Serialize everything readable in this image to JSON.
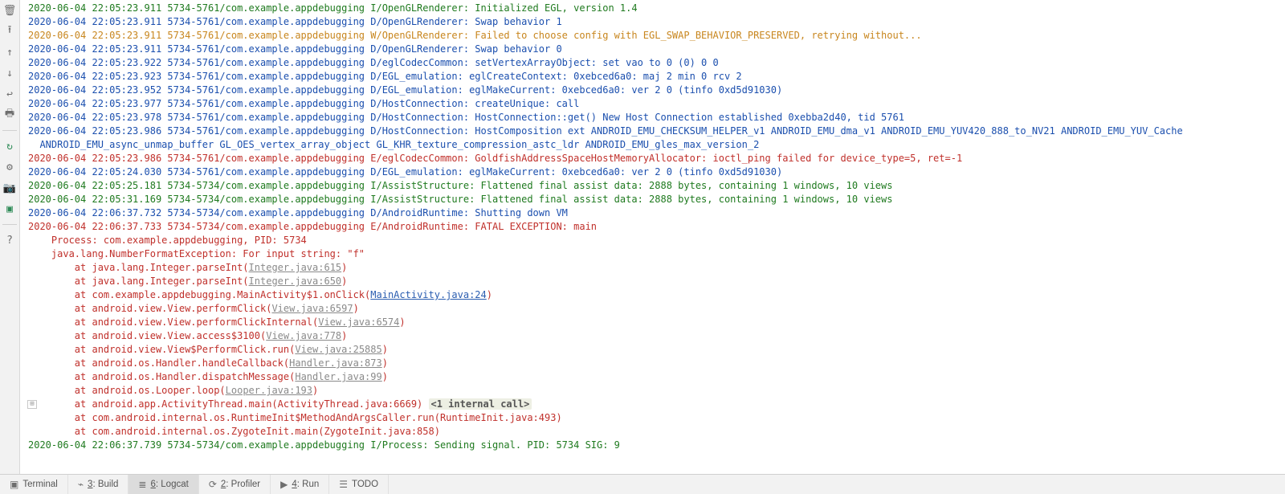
{
  "gutter": {
    "icons": [
      {
        "name": "trash-icon",
        "glyph": "🗑"
      },
      {
        "name": "scroll-end-icon",
        "glyph": "⭱"
      },
      {
        "name": "up-icon",
        "glyph": "↑"
      },
      {
        "name": "down-icon",
        "glyph": "↓"
      },
      {
        "name": "soft-wrap-icon",
        "glyph": "↩"
      },
      {
        "name": "print-icon",
        "glyph": "🖶"
      },
      {
        "sep": true
      },
      {
        "name": "restart-icon",
        "glyph": "↻",
        "cls": "green"
      },
      {
        "name": "settings-icon",
        "glyph": "⚙"
      },
      {
        "name": "screenshot-icon",
        "glyph": "📷",
        "cls": "blue"
      },
      {
        "name": "record-icon",
        "glyph": "▣",
        "cls": "green"
      },
      {
        "sep": true
      },
      {
        "name": "help-icon",
        "glyph": "?"
      }
    ]
  },
  "expand_glyph": "⊞",
  "log": {
    "prefix_pkg": "com.example.appdebugging",
    "lines": [
      {
        "lvl": "I",
        "ts": "2020-06-04 22:05:23.911",
        "pid": "5734-5761",
        "tag": "OpenGLRenderer",
        "msg": "Initialized EGL, version 1.4"
      },
      {
        "lvl": "D",
        "ts": "2020-06-04 22:05:23.911",
        "pid": "5734-5761",
        "tag": "OpenGLRenderer",
        "msg": "Swap behavior 1"
      },
      {
        "lvl": "W",
        "ts": "2020-06-04 22:05:23.911",
        "pid": "5734-5761",
        "tag": "OpenGLRenderer",
        "msg": "Failed to choose config with EGL_SWAP_BEHAVIOR_PRESERVED, retrying without..."
      },
      {
        "lvl": "D",
        "ts": "2020-06-04 22:05:23.911",
        "pid": "5734-5761",
        "tag": "OpenGLRenderer",
        "msg": "Swap behavior 0"
      },
      {
        "lvl": "D",
        "ts": "2020-06-04 22:05:23.922",
        "pid": "5734-5761",
        "tag": "eglCodecCommon",
        "msg": "setVertexArrayObject: set vao to 0 (0) 0 0"
      },
      {
        "lvl": "D",
        "ts": "2020-06-04 22:05:23.923",
        "pid": "5734-5761",
        "tag": "EGL_emulation",
        "msg": "eglCreateContext: 0xebced6a0: maj 2 min 0 rcv 2"
      },
      {
        "lvl": "D",
        "ts": "2020-06-04 22:05:23.952",
        "pid": "5734-5761",
        "tag": "EGL_emulation",
        "msg": "eglMakeCurrent: 0xebced6a0: ver 2 0 (tinfo 0xd5d91030)"
      },
      {
        "lvl": "D",
        "ts": "2020-06-04 22:05:23.977",
        "pid": "5734-5761",
        "tag": "HostConnection",
        "msg": "createUnique: call"
      },
      {
        "lvl": "D",
        "ts": "2020-06-04 22:05:23.978",
        "pid": "5734-5761",
        "tag": "HostConnection",
        "msg": "HostConnection::get() New Host Connection established 0xebba2d40, tid 5761"
      },
      {
        "lvl": "D",
        "ts": "2020-06-04 22:05:23.986",
        "pid": "5734-5761",
        "tag": "HostConnection",
        "msg": "HostComposition ext ANDROID_EMU_CHECKSUM_HELPER_v1 ANDROID_EMU_dma_v1 ANDROID_EMU_YUV420_888_to_NV21 ANDROID_EMU_YUV_Cache"
      },
      {
        "cont": true,
        "lvl": "D",
        "msg": "  ANDROID_EMU_async_unmap_buffer GL_OES_vertex_array_object GL_KHR_texture_compression_astc_ldr ANDROID_EMU_gles_max_version_2 "
      },
      {
        "lvl": "E",
        "ts": "2020-06-04 22:05:23.986",
        "pid": "5734-5761",
        "tag": "eglCodecCommon",
        "msg": "GoldfishAddressSpaceHostMemoryAllocator: ioctl_ping failed for device_type=5, ret=-1"
      },
      {
        "lvl": "D",
        "ts": "2020-06-04 22:05:24.030",
        "pid": "5734-5761",
        "tag": "EGL_emulation",
        "msg": "eglMakeCurrent: 0xebced6a0: ver 2 0 (tinfo 0xd5d91030)"
      },
      {
        "lvl": "I",
        "ts": "2020-06-04 22:05:25.181",
        "pid": "5734-5734",
        "tag": "AssistStructure",
        "msg": "Flattened final assist data: 2888 bytes, containing 1 windows, 10 views"
      },
      {
        "lvl": "I",
        "ts": "2020-06-04 22:05:31.169",
        "pid": "5734-5734",
        "tag": "AssistStructure",
        "msg": "Flattened final assist data: 2888 bytes, containing 1 windows, 10 views"
      },
      {
        "lvl": "D",
        "ts": "2020-06-04 22:06:37.732",
        "pid": "5734-5734",
        "tag": "AndroidRuntime",
        "msg": "Shutting down VM"
      },
      {
        "lvl": "E",
        "ts": "2020-06-04 22:06:37.733",
        "pid": "5734-5734",
        "tag": "AndroidRuntime",
        "msg": "FATAL EXCEPTION: main"
      },
      {
        "trace": true,
        "indent": "    ",
        "text": "Process: com.example.appdebugging, PID: 5734"
      },
      {
        "trace": true,
        "indent": "    ",
        "text": "java.lang.NumberFormatException: For input string: \"f\""
      },
      {
        "trace": true,
        "indent": "        ",
        "text": "at java.lang.Integer.parseInt(",
        "link": "Integer.java:615",
        "text2": ")"
      },
      {
        "trace": true,
        "indent": "        ",
        "text": "at java.lang.Integer.parseInt(",
        "link": "Integer.java:650",
        "text2": ")"
      },
      {
        "trace": true,
        "indent": "        ",
        "text": "at com.example.appdebugging.MainActivity$1.onClick(",
        "link": "MainActivity.java:24",
        "active": true,
        "text2": ")"
      },
      {
        "trace": true,
        "indent": "        ",
        "text": "at android.view.View.performClick(",
        "link": "View.java:6597",
        "text2": ")"
      },
      {
        "trace": true,
        "indent": "        ",
        "text": "at android.view.View.performClickInternal(",
        "link": "View.java:6574",
        "text2": ")"
      },
      {
        "trace": true,
        "indent": "        ",
        "text": "at android.view.View.access$3100(",
        "link": "View.java:778",
        "text2": ")"
      },
      {
        "trace": true,
        "indent": "        ",
        "text": "at android.view.View$PerformClick.run(",
        "link": "View.java:25885",
        "text2": ")"
      },
      {
        "trace": true,
        "indent": "        ",
        "text": "at android.os.Handler.handleCallback(",
        "link": "Handler.java:873",
        "text2": ")"
      },
      {
        "trace": true,
        "indent": "        ",
        "text": "at android.os.Handler.dispatchMessage(",
        "link": "Handler.java:99",
        "text2": ")"
      },
      {
        "trace": true,
        "indent": "        ",
        "text": "at android.os.Looper.loop(",
        "link": "Looper.java:193",
        "text2": ")"
      },
      {
        "trace": true,
        "indent": "        ",
        "text": "at android.app.ActivityThread.main(ActivityThread.java:6669) ",
        "hint": "<1 internal call>",
        "expand": true
      },
      {
        "trace": true,
        "indent": "        ",
        "text": "at com.android.internal.os.RuntimeInit$MethodAndArgsCaller.run(RuntimeInit.java:493)"
      },
      {
        "trace": true,
        "indent": "        ",
        "text": "at com.android.internal.os.ZygoteInit.main(ZygoteInit.java:858)"
      },
      {
        "lvl": "I",
        "ts": "2020-06-04 22:06:37.739",
        "pid": "5734-5734",
        "tag": "Process",
        "msg": "Sending signal. PID: 5734 SIG: 9"
      }
    ]
  },
  "bottom_tabs": [
    {
      "name": "tab-terminal",
      "icon": "▣",
      "label": "Terminal"
    },
    {
      "name": "tab-build",
      "icon": "⌁",
      "shortcut": "3:",
      "label": "Build"
    },
    {
      "name": "tab-logcat",
      "icon": "≣",
      "shortcut": "6:",
      "label": "Logcat",
      "active": true
    },
    {
      "name": "tab-profiler",
      "icon": "⟳",
      "shortcut": "2:",
      "label": "Profiler"
    },
    {
      "name": "tab-run",
      "icon": "▶",
      "shortcut": "4:",
      "label": "Run"
    },
    {
      "name": "tab-todo",
      "icon": "☰",
      "label": "TODO"
    }
  ]
}
